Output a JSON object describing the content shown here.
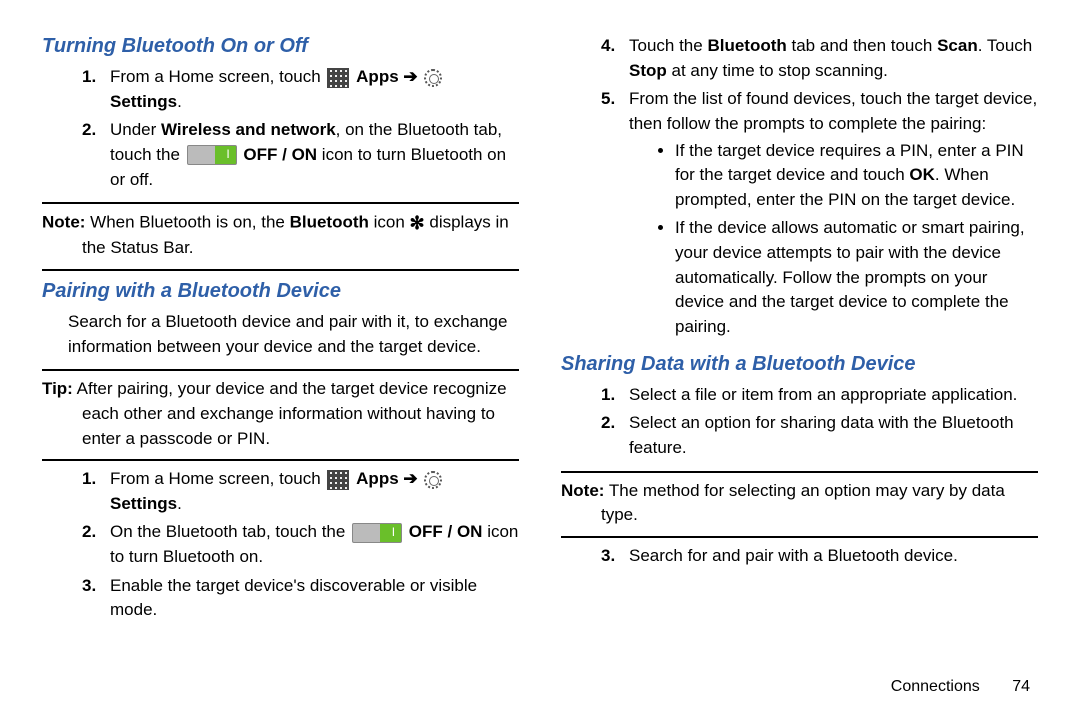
{
  "left": {
    "h1": "Turning Bluetooth On or Off",
    "step1_a": "From a Home screen, touch ",
    "apps_label": " Apps ",
    "arrow": "➔",
    "settings_label": " Settings",
    "period": ".",
    "step2_a": "Under ",
    "step2_b": "Wireless and network",
    "step2_c": ", on the Bluetooth tab, touch the ",
    "step2_d": " OFF / ON",
    "step2_e": " icon to turn Bluetooth on or off.",
    "note_label": "Note:",
    "note_a": " When Bluetooth is on, the ",
    "note_b": "Bluetooth",
    "note_c": " icon ",
    "bt_glyph": "✻",
    "note_d": " displays in the Status Bar.",
    "h2": "Pairing with a Bluetooth Device",
    "para1": "Search for a Bluetooth device and pair with it, to exchange information between your device and the target device.",
    "tip_label": "Tip:",
    "tip_text": " After pairing, your device and the target device recognize each other and exchange information without having to enter a passcode or PIN.",
    "p_step2_a": "On the Bluetooth tab, touch the ",
    "p_step2_b": " OFF / ON",
    "p_step2_c": " icon to turn Bluetooth on.",
    "p_step3": "Enable the target device's discoverable or visible mode."
  },
  "right": {
    "step4_a": "Touch the ",
    "step4_b": "Bluetooth",
    "step4_c": " tab and then touch ",
    "step4_d": "Scan",
    "step4_e": ". Touch ",
    "step4_f": "Stop",
    "step4_g": " at any time to stop scanning.",
    "step5": "From the list of found devices, touch the target device, then follow the prompts to complete the pairing:",
    "bullet1_a": "If the target device requires a PIN, enter a PIN for the target device and touch ",
    "bullet1_b": "OK",
    "bullet1_c": ". When prompted, enter the PIN on the target device.",
    "bullet2": "If the device allows automatic or smart pairing, your device attempts to pair with the device automatically. Follow the prompts on your device and the target device to complete the pairing.",
    "h3": "Sharing Data with a Bluetooth Device",
    "s_step1": "Select a file or item from an appropriate application.",
    "s_step2": "Select an option for sharing data with the Bluetooth feature.",
    "note2_label": "Note:",
    "note2_text": " The method for selecting an option may vary by data type.",
    "s_step3": "Search for and pair with a Bluetooth device."
  },
  "nums": {
    "n1": "1.",
    "n2": "2.",
    "n3": "3.",
    "n4": "4.",
    "n5": "5."
  },
  "footer": {
    "section": "Connections",
    "page": "74"
  }
}
